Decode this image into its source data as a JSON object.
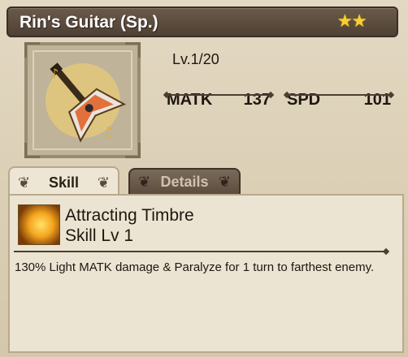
{
  "item": {
    "title": "Rin's Guitar (Sp.)",
    "stars": "★★",
    "level": "Lv.1/20",
    "stats": [
      {
        "name": "MATK",
        "value": "137"
      },
      {
        "name": "SPD",
        "value": "101"
      }
    ]
  },
  "tabs": {
    "skill_label": "Skill",
    "details_label": "Details"
  },
  "skill": {
    "name": "Attracting Timbre",
    "level_text": "Skill Lv 1",
    "description": "130% Light MATK damage & Paralyze for 1 turn to farthest enemy."
  },
  "colors": {
    "title_bar": "#4e4034",
    "star": "#f5d032",
    "panel": "#ece4d2",
    "text": "#1e1710"
  }
}
